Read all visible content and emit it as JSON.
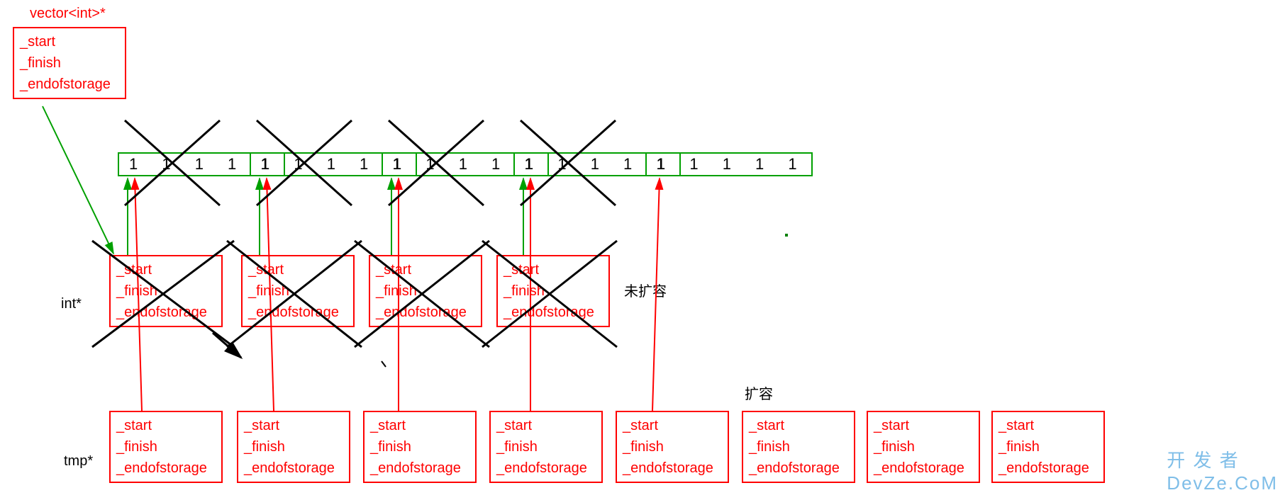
{
  "title_label": "vector<int>*",
  "pointer_box": {
    "start": "_start",
    "finish": "_finish",
    "eos": "_endofstorage"
  },
  "green_cells": [
    "1 1 1 1 1",
    "1 1 1 1 1",
    "1 1 1 1 1",
    "1 1 1 1 1",
    "1 1 1 1 1"
  ],
  "int_label": "int*",
  "tmp_label": "tmp*",
  "no_expand_label": "未扩容",
  "expand_label": "扩容",
  "mid_boxes_count": 4,
  "bottom_boxes_count": 8,
  "watermark": "开 发 者  DevZe.CoM"
}
